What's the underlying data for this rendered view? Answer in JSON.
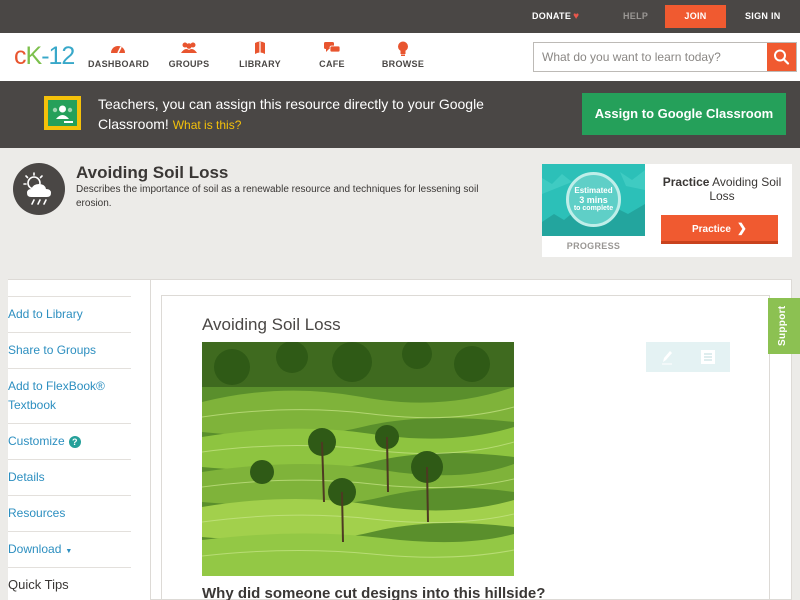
{
  "topbar": {
    "donate": "DONATE",
    "help": "HELP",
    "join": "JOIN",
    "sign_in": "SIGN IN"
  },
  "logo": {
    "c": "c",
    "k": "K",
    "num": "-12"
  },
  "nav": {
    "dashboard": "DASHBOARD",
    "groups": "GROUPS",
    "library": "LIBRARY",
    "cafe": "CAFE",
    "browse": "BROWSE"
  },
  "search": {
    "placeholder": "What do you want to learn today?"
  },
  "banner": {
    "text": "Teachers, you can assign this resource directly to your Google Classroom!",
    "what_link": "What is this?",
    "assign_button": "Assign to Google Classroom"
  },
  "header": {
    "title": "Avoiding Soil Loss",
    "description": "Describes the importance of soil as a renewable resource and techniques for lessening soil erosion."
  },
  "practice": {
    "estimated": "Estimated",
    "duration": "3 mins",
    "to_complete": "to complete",
    "progress_label": "PROGRESS",
    "title_bold": "Practice",
    "title_rest": "Avoiding Soil Loss",
    "button": "Practice"
  },
  "sidebar": {
    "add_library": "Add to Library",
    "share_groups": "Share to Groups",
    "add_flexbook": "Add to FlexBook® Textbook",
    "customize": "Customize",
    "details": "Details",
    "resources": "Resources",
    "download": "Download",
    "quick_tips": "Quick Tips"
  },
  "card": {
    "title": "Avoiding Soil Loss",
    "question": "Why did someone cut designs into this hillside?"
  },
  "support": "Support",
  "colors": {
    "brand_orange": "#f05a30",
    "google_green": "#25a05a",
    "dark_bar": "#4a4745",
    "link_blue": "#2d8fc0",
    "support_green": "#8cc152"
  }
}
